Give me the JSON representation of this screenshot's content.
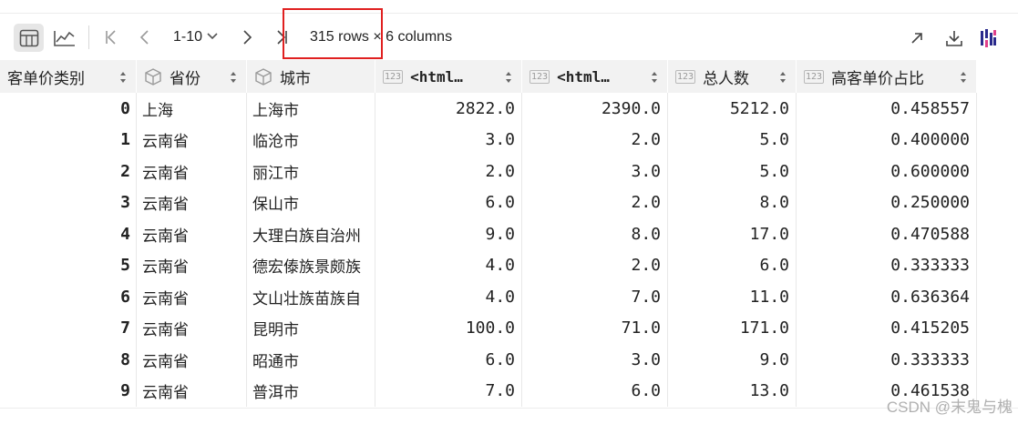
{
  "toolbar": {
    "page_range": "1-10",
    "shape_info": "315 rows × 6 columns"
  },
  "table": {
    "headers": {
      "index": "客单价类别",
      "c1": "省份",
      "c2": "城市",
      "c3": "<html…",
      "c4": "<html…",
      "c5": "总人数",
      "c6": "高客单价占比"
    },
    "type_label": "123",
    "rows": [
      {
        "idx": "0",
        "province": "上海",
        "city": "上海市",
        "v1": "2822.0",
        "v2": "2390.0",
        "total": "5212.0",
        "ratio": "0.458557"
      },
      {
        "idx": "1",
        "province": "云南省",
        "city": "临沧市",
        "v1": "3.0",
        "v2": "2.0",
        "total": "5.0",
        "ratio": "0.400000"
      },
      {
        "idx": "2",
        "province": "云南省",
        "city": "丽江市",
        "v1": "2.0",
        "v2": "3.0",
        "total": "5.0",
        "ratio": "0.600000"
      },
      {
        "idx": "3",
        "province": "云南省",
        "city": "保山市",
        "v1": "6.0",
        "v2": "2.0",
        "total": "8.0",
        "ratio": "0.250000"
      },
      {
        "idx": "4",
        "province": "云南省",
        "city": "大理白族自治州",
        "v1": "9.0",
        "v2": "8.0",
        "total": "17.0",
        "ratio": "0.470588"
      },
      {
        "idx": "5",
        "province": "云南省",
        "city": "德宏傣族景颇族",
        "v1": "4.0",
        "v2": "2.0",
        "total": "6.0",
        "ratio": "0.333333"
      },
      {
        "idx": "6",
        "province": "云南省",
        "city": "文山壮族苗族自",
        "v1": "4.0",
        "v2": "7.0",
        "total": "11.0",
        "ratio": "0.636364"
      },
      {
        "idx": "7",
        "province": "云南省",
        "city": "昆明市",
        "v1": "100.0",
        "v2": "71.0",
        "total": "171.0",
        "ratio": "0.415205"
      },
      {
        "idx": "8",
        "province": "云南省",
        "city": "昭通市",
        "v1": "6.0",
        "v2": "3.0",
        "total": "9.0",
        "ratio": "0.333333"
      },
      {
        "idx": "9",
        "province": "云南省",
        "city": "普洱市",
        "v1": "7.0",
        "v2": "6.0",
        "total": "13.0",
        "ratio": "0.461538"
      }
    ]
  },
  "watermark": "CSDN @末鬼与槐",
  "colors": {
    "highlight": "#e02020",
    "header_bg": "#f2f2f2",
    "active_view_bg": "#e6e6e6"
  }
}
